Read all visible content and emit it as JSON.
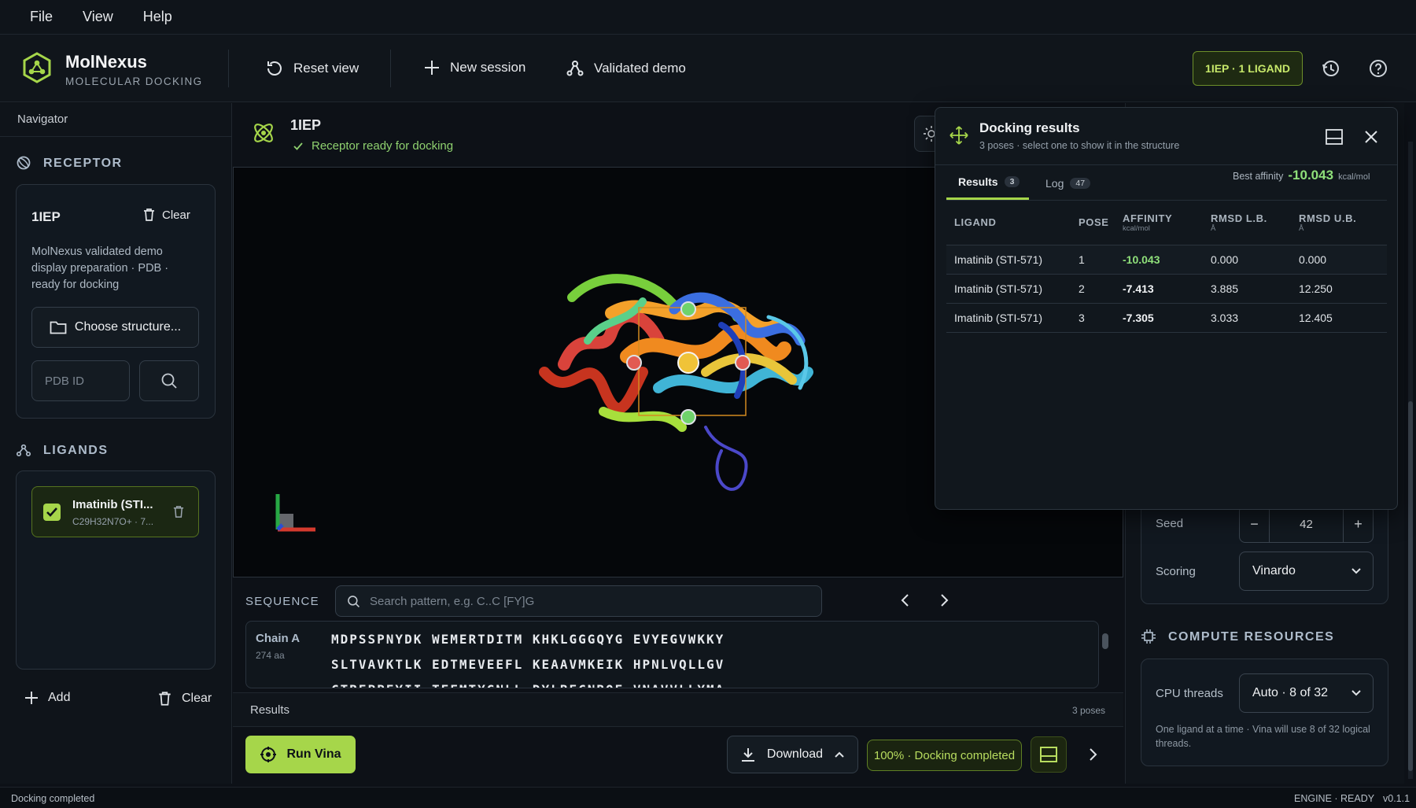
{
  "menu": [
    "File",
    "View",
    "Help"
  ],
  "brand": {
    "title": "MolNexus",
    "subtitle": "MOLECULAR DOCKING"
  },
  "header": {
    "reset_view": "Reset view",
    "new_session": "New session",
    "validated_demo": "Validated demo",
    "status_badge": "1IEP · 1 LIGAND"
  },
  "navigator": {
    "label": "Navigator"
  },
  "receptor": {
    "section_title": "RECEPTOR",
    "id": "1IEP",
    "clear": "Clear",
    "description": "MolNexus validated demo display preparation · PDB · ready for docking",
    "choose_structure": "Choose structure...",
    "pdb_placeholder": "PDB ID"
  },
  "ligands": {
    "section_title": "LIGANDS",
    "items": [
      {
        "name": "Imatinib (STI...",
        "formula": "C29H32N7O+ · 7..."
      }
    ],
    "add": "Add",
    "clear": "Clear"
  },
  "structure": {
    "id": "1IEP",
    "status": "Receptor ready for docking"
  },
  "sequence": {
    "label": "SEQUENCE",
    "search_placeholder": "Search pattern, e.g. C..C  [FY]G",
    "chain": "Chain A",
    "length": "274 aa",
    "rows": [
      "MDPSSPNYDK WEMERTDITM KHKLGGGQYG EVYEGVWKKY",
      "SLTVAVKTLK EDTMEVEEFL KEAAVMKEIK HPNLVQLLGV",
      "CTREPPFYII TEFMTYGNLL DYLRECNRQE VNAVVLLYMA"
    ]
  },
  "results_bar": {
    "label": "Results",
    "count": "3 poses"
  },
  "actions": {
    "run_vina": "Run Vina",
    "download": "Download",
    "progress": "100% · Docking completed",
    "progress_value": 1.0
  },
  "docking": {
    "title": "Docking results",
    "subtitle": "3 poses · select one to show it in the structure",
    "tabs": [
      {
        "label": "Results",
        "count": "3"
      },
      {
        "label": "Log",
        "count": "47"
      }
    ],
    "best_affinity_label": "Best affinity",
    "best_affinity_value": "-10.043",
    "best_affinity_unit": "kcal/mol",
    "columns": [
      {
        "label": "LIGAND",
        "sub": ""
      },
      {
        "label": "POSE",
        "sub": ""
      },
      {
        "label": "AFFINITY",
        "sub": "kcal/mol"
      },
      {
        "label": "RMSD L.B.",
        "sub": "Å"
      },
      {
        "label": "RMSD U.B.",
        "sub": "Å"
      }
    ],
    "rows": [
      {
        "ligand": "Imatinib (STI-571)",
        "pose": "1",
        "affinity": "-10.043",
        "rmsd_lb": "0.000",
        "rmsd_ub": "0.000"
      },
      {
        "ligand": "Imatinib (STI-571)",
        "pose": "2",
        "affinity": "-7.413",
        "rmsd_lb": "3.885",
        "rmsd_ub": "12.250"
      },
      {
        "ligand": "Imatinib (STI-571)",
        "pose": "3",
        "affinity": "-7.305",
        "rmsd_lb": "3.033",
        "rmsd_ub": "12.405"
      }
    ]
  },
  "params": {
    "seed_label": "Seed",
    "seed_value": "42",
    "scoring_label": "Scoring",
    "scoring_value": "Vinardo"
  },
  "compute": {
    "section_title": "COMPUTE RESOURCES",
    "cpu_label": "CPU threads",
    "cpu_value": "Auto · 8 of 32",
    "note": "One ligand at a time · Vina will use 8 of 32 logical threads."
  },
  "status": {
    "left": "Docking completed",
    "engine": "ENGINE · READY",
    "version": "v0.1.1"
  },
  "colors": {
    "accent": "#a6d64a",
    "best_affinity": "#8fe07a",
    "background": "#0d1117"
  }
}
